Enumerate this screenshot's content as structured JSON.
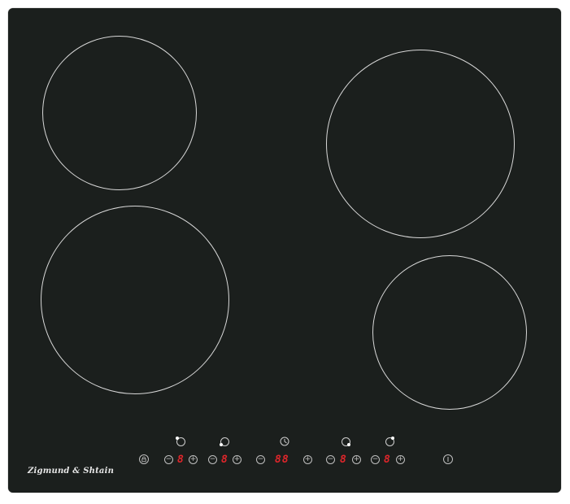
{
  "brand": {
    "name": "Zigmund & Shtain"
  },
  "colors": {
    "glass": "#1b1f1d",
    "ring": "#d8d8d8",
    "display": "#e0262b",
    "control": "#bfbfbf"
  },
  "controls": {
    "minus_symbol": "−",
    "plus_symbol": "+",
    "zone_digit": "8",
    "timer_digits": "88"
  },
  "icons": {
    "lock": "lock-icon",
    "power": "power-icon",
    "timer": "clock-icon",
    "zones": [
      "zone-front-left-icon",
      "zone-rear-left-icon",
      "zone-rear-right-icon",
      "zone-front-right-icon"
    ]
  }
}
